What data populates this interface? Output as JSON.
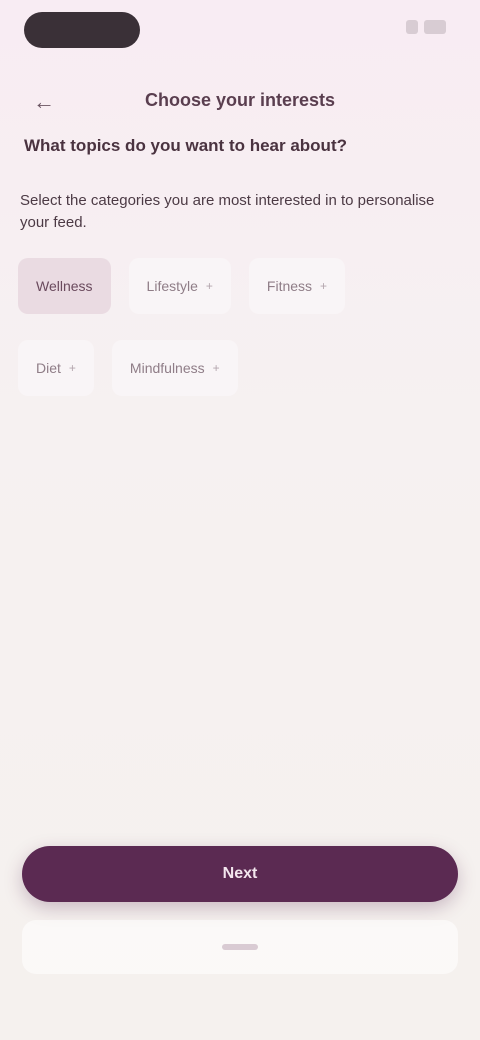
{
  "header": {
    "back_icon": "arrow-left-icon",
    "title": "Choose your interests"
  },
  "question": "What topics do you want to hear about?",
  "subtitle": "Select the categories you are most interested in to personalise your feed.",
  "chips": {
    "row1": [
      {
        "label": "Wellness",
        "selected": true
      },
      {
        "label": "Lifestyle",
        "selected": false
      },
      {
        "label": "Fitness",
        "selected": false
      }
    ],
    "row2": [
      {
        "label": "Diet",
        "selected": false
      },
      {
        "label": "Mindfulness",
        "selected": false
      }
    ]
  },
  "primary_button": "Next",
  "colors": {
    "accent": "#5b2a52",
    "chip_selected": "#eadbe2",
    "background": "#f6f1f1"
  }
}
